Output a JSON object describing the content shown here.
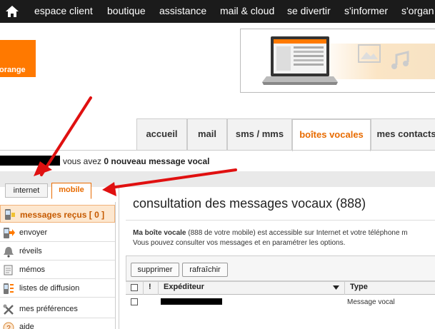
{
  "topnav": {
    "items": [
      "espace client",
      "boutique",
      "assistance",
      "mail & cloud",
      "se divertir",
      "s'informer",
      "s'organ"
    ]
  },
  "logo": {
    "text": "orange"
  },
  "tabs": [
    "accueil",
    "mail",
    "sms / mms",
    "boîtes vocales",
    "mes contacts"
  ],
  "active_tab": "boîtes vocales",
  "status": {
    "prefix": "vous avez ",
    "count": "0",
    "suffix": " nouveau message vocal"
  },
  "left_tabs": [
    "internet",
    "mobile"
  ],
  "left_menu": [
    "messages reçus [ 0 ]",
    "envoyer",
    "réveils",
    "mémos",
    "listes de diffusion",
    "mes préférences",
    "aide"
  ],
  "main": {
    "title": "consultation des messages vocaux (888)",
    "desc_bold": "Ma boîte vocale",
    "desc_rest": " (888 de votre mobile) est accessible sur Internet et votre téléphone m",
    "desc_line2": "Vous pouvez consulter vos messages et en paramétrer les options.",
    "buttons": [
      "supprimer",
      "rafraîchir"
    ],
    "columns": [
      "!",
      "Expéditeur",
      "Type"
    ],
    "rows": [
      {
        "type": "Message vocal"
      }
    ]
  },
  "colors": {
    "brand": "#ff7900",
    "accent_text": "#e86b00",
    "arrow": "#e01010",
    "nav_bg": "#1b1b1b"
  }
}
